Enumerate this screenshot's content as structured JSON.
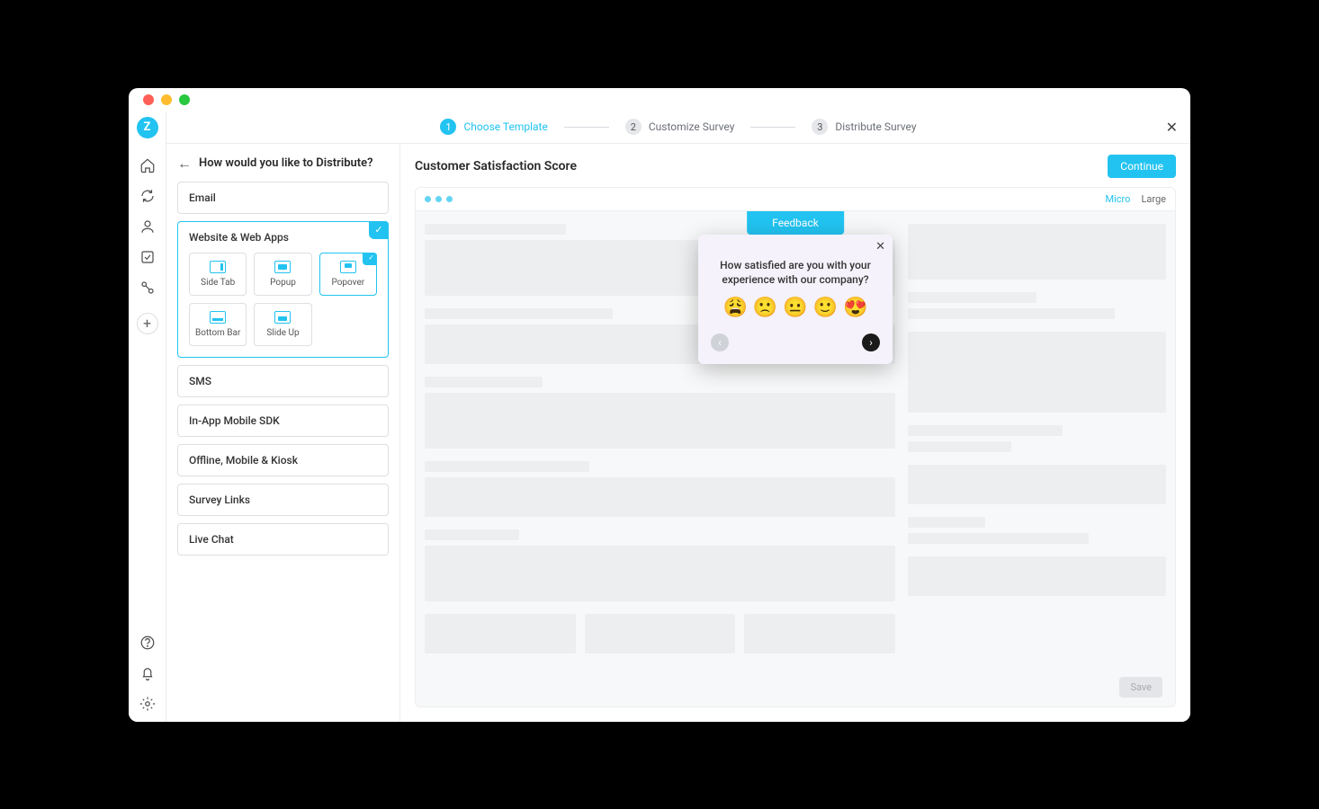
{
  "stepper": {
    "steps": [
      {
        "num": "1",
        "label": "Choose Template",
        "active": true
      },
      {
        "num": "2",
        "label": "Customize Survey",
        "active": false
      },
      {
        "num": "3",
        "label": "Distribute Survey",
        "active": false
      }
    ]
  },
  "leftPanel": {
    "title": "How would you like to Distribute?",
    "options": {
      "email": "Email",
      "web": "Website & Web Apps",
      "sms": "SMS",
      "sdk": "In-App Mobile SDK",
      "offline": "Offline, Mobile & Kiosk",
      "links": "Survey Links",
      "chat": "Live Chat"
    },
    "webSub": {
      "sidetab": "Side Tab",
      "popup": "Popup",
      "popover": "Popover",
      "bottombar": "Bottom Bar",
      "slideup": "Slide Up"
    }
  },
  "right": {
    "title": "Customer Satisfaction Score",
    "continue": "Continue",
    "sizes": {
      "micro": "Micro",
      "large": "Large"
    },
    "feedbackTab": "Feedback",
    "question": "How satisfied are you with your experience with our company?",
    "emojis": [
      "😩",
      "🙁",
      "😐",
      "🙂",
      "😍"
    ],
    "saveGhost": "Save"
  }
}
